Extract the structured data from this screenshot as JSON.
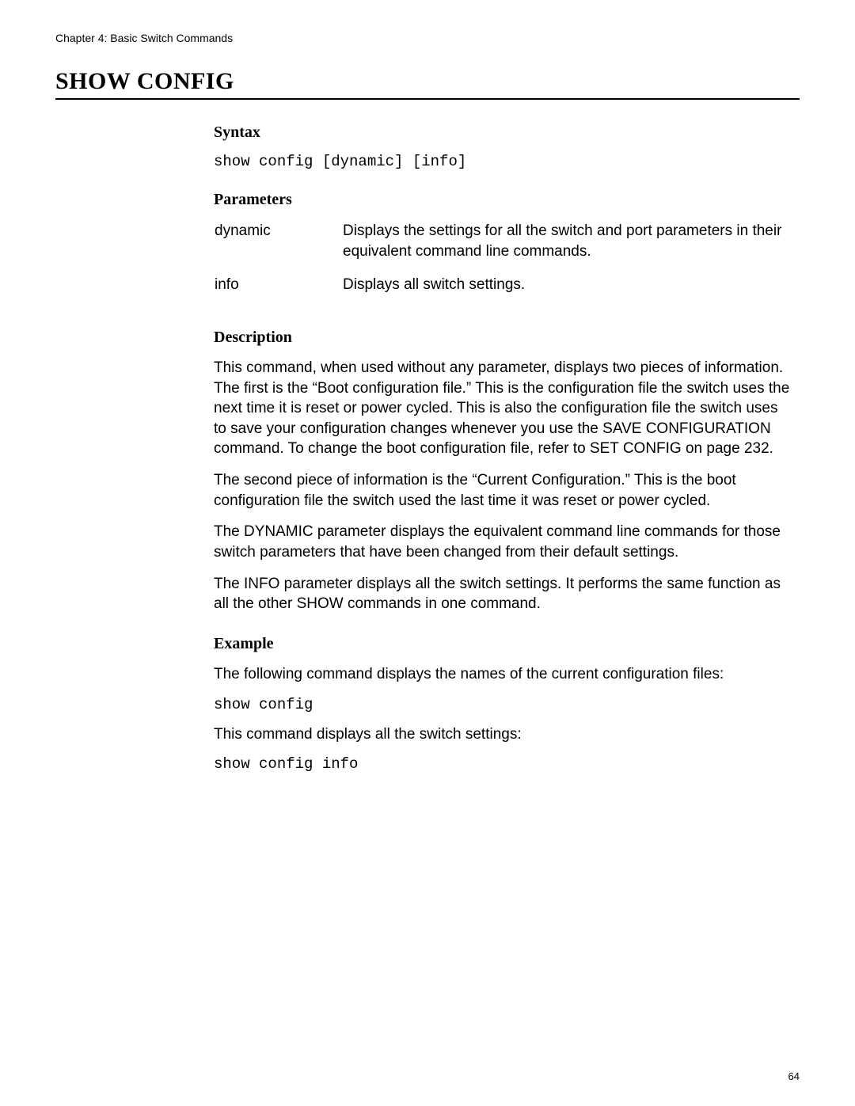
{
  "chapter_header": "Chapter 4: Basic Switch Commands",
  "main_title": "SHOW CONFIG",
  "sections": {
    "syntax": {
      "heading": "Syntax",
      "code": "show config [dynamic] [info]"
    },
    "parameters": {
      "heading": "Parameters",
      "rows": [
        {
          "name": "dynamic",
          "desc": "Displays the settings for all the switch and port parameters in their equivalent command line commands."
        },
        {
          "name": "info",
          "desc": "Displays all switch settings."
        }
      ]
    },
    "description": {
      "heading": "Description",
      "paragraphs": [
        "This command, when used without any parameter, displays two pieces of information. The first is the “Boot configuration file.” This is the configuration file the switch uses the next time it is reset or power cycled. This is also the configuration file the switch uses to save your configuration changes whenever you use the SAVE CONFIGURATION command. To change the boot configuration file, refer to SET CONFIG on page 232.",
        "The second piece of information is the “Current Configuration.” This is the boot configuration file the switch used the last time it was reset or power cycled.",
        "The DYNAMIC parameter displays the equivalent command line commands for those switch parameters that have been changed from their default settings.",
        "The INFO parameter displays all the switch settings. It performs the same function as all the other SHOW commands in one command."
      ]
    },
    "example": {
      "heading": "Example",
      "intro1": "The following command displays the names of the current configuration files:",
      "code1": "show config",
      "intro2": "This command displays all the switch settings:",
      "code2": "show config info"
    }
  },
  "page_number": "64"
}
